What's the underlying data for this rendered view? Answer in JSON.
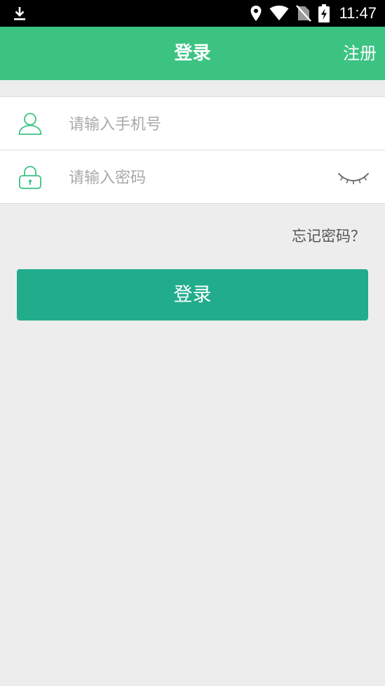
{
  "status_bar": {
    "time": "11:47",
    "icons": [
      "download-icon",
      "location-icon",
      "wifi-icon",
      "no-sim-icon",
      "battery-charging-icon"
    ]
  },
  "app_bar": {
    "title": "登录",
    "register_label": "注册",
    "background": "#3cc382"
  },
  "form": {
    "phone": {
      "icon": "user-icon",
      "placeholder": "请输入手机号",
      "value": ""
    },
    "password": {
      "icon": "lock-icon",
      "placeholder": "请输入密码",
      "value": "",
      "toggle_icon": "eye-closed-icon"
    }
  },
  "forgot_password_label": "忘记密码？",
  "login_button": {
    "label": "登录",
    "color": "#21ad8c"
  },
  "colors": {
    "accent": "#3cc382",
    "button": "#21ad8c",
    "background": "#ededed"
  }
}
